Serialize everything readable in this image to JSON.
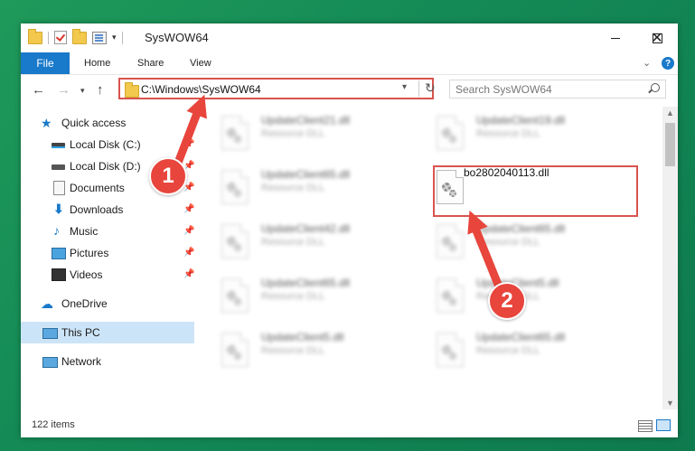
{
  "window": {
    "title": "SysWOW64"
  },
  "ribbon": {
    "tabs": [
      "File",
      "Home",
      "Share",
      "View"
    ]
  },
  "address": {
    "path": "C:\\Windows\\SysWOW64"
  },
  "search": {
    "placeholder": "Search SysWOW64"
  },
  "nav": {
    "items": [
      {
        "label": "Quick access",
        "icon": "star-icon"
      },
      {
        "label": "Local Disk (C:)",
        "icon": "disk-icon",
        "pinned": true
      },
      {
        "label": "Local Disk (D:)",
        "icon": "disk-icon",
        "pinned": true
      },
      {
        "label": "Documents",
        "icon": "documents-icon",
        "pinned": true
      },
      {
        "label": "Downloads",
        "icon": "downloads-icon",
        "pinned": true
      },
      {
        "label": "Music",
        "icon": "music-icon",
        "pinned": true
      },
      {
        "label": "Pictures",
        "icon": "pictures-icon",
        "pinned": true
      },
      {
        "label": "Videos",
        "icon": "videos-icon",
        "pinned": true
      },
      {
        "label": "OneDrive",
        "icon": "cloud-icon"
      },
      {
        "label": "This PC",
        "icon": "computer-icon",
        "selected": true
      },
      {
        "label": "Network",
        "icon": "network-icon"
      }
    ]
  },
  "files": [
    {
      "name": "UpdateClient21.dll",
      "type": "Resource DLL",
      "blurred": true
    },
    {
      "name": "UpdateClient19.dll",
      "type": "Resource DLL",
      "blurred": true
    },
    {
      "name": "UpdateClient65.dll",
      "type": "Resource DLL",
      "blurred": true
    },
    {
      "name": "bo2802040113.dll",
      "type": "",
      "blurred": false
    },
    {
      "name": "UpdateClient42.dll",
      "type": "Resource DLL",
      "blurred": true
    },
    {
      "name": "UpdateClient65.dll",
      "type": "Resource DLL",
      "blurred": true
    },
    {
      "name": "UpdateClient65.dll",
      "type": "Resource DLL",
      "blurred": true
    },
    {
      "name": "UpdateClient5.dll",
      "type": "Resource DLL",
      "blurred": true
    },
    {
      "name": "UpdateClient5.dll",
      "type": "Resource DLL",
      "blurred": true
    },
    {
      "name": "UpdateClient65.dll",
      "type": "Resource DLL",
      "blurred": true
    }
  ],
  "status": {
    "item_count": "122 items"
  },
  "annotations": {
    "step1": "1",
    "step2": "2"
  },
  "colors": {
    "accent": "#1979ca",
    "annotation": "#e8453c",
    "highlight_border": "#d9534f",
    "desktop": "#148a56"
  }
}
